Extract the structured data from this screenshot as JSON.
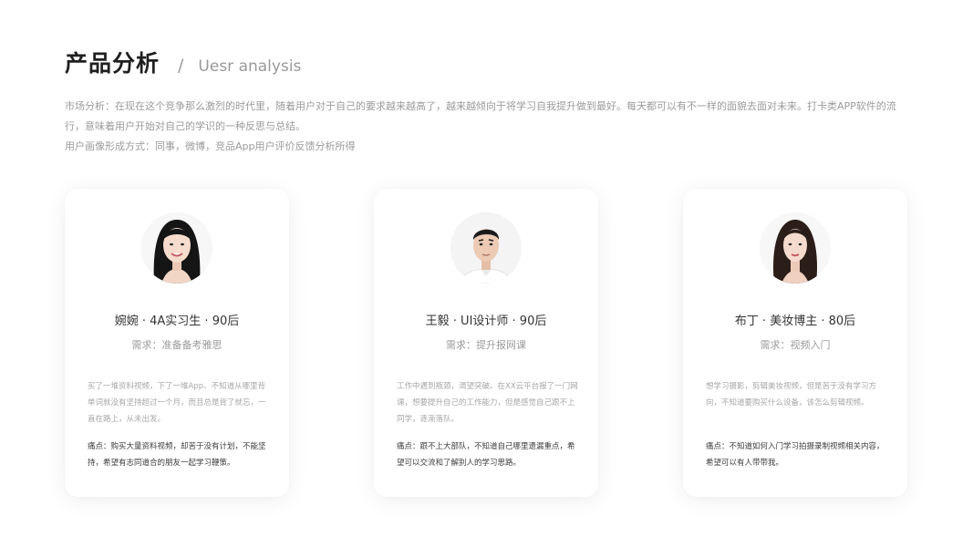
{
  "header": {
    "title": "产品分析",
    "slash": "/",
    "subtitle": "Uesr analysis"
  },
  "intro": {
    "line1": "市场分析：在现在这个竞争那么激烈的时代里，随着用户对于自己的要求越来越高了，越来越倾向于将学习自我提升做到最好。每天都可以有不一样的面貌去面对未来。打卡类APP软件的流行，意味着用户开始对自己的学识的一种反思与总结。",
    "line2": "用户画像形成方式：同事，微博，竞品App用户评价反馈分析所得"
  },
  "cards": [
    {
      "name": "婉婉 · 4A实习生 · 90后",
      "need": "需求：准备备考雅思",
      "desc": "买了一堆资料视频，下了一堆App、不知道从哪里背单词就没有坚持超过一个月，而且总是背了就忘，一直在路上，从未出发。",
      "pain": "痛点：购买大量资料视频，却苦于没有计划，不能坚持，希望有志同道合的朋友一起学习鞭策。"
    },
    {
      "name": "王毅 · UI设计师 · 90后",
      "need": "需求：提升报网课",
      "desc": "工作中遇到瓶颈，渴望突破。在XX云平台报了一门网课，想要提升自己的工作能力，但是感觉自己跟不上同学，逐渐落队。",
      "pain": "痛点：跟不上大部队，不知道自己哪里遗漏重点，希望可以交流和了解别人的学习思路。"
    },
    {
      "name": "布丁 · 美妆博主 · 80后",
      "need": "需求：视频入门",
      "desc": "想学习摄影，剪辑美妆视频，但是苦于没有学习方向，不知道要购买什么设备，该怎么剪辑视频。",
      "pain": "痛点：不知道如何入门学习拍摄录制视频相关内容，希望可以有人带带我。"
    }
  ],
  "colors": {
    "title": "#1f1f1f",
    "muted": "#9b9b9b",
    "body": "#3d3d3d",
    "card_bg": "#ffffff"
  }
}
